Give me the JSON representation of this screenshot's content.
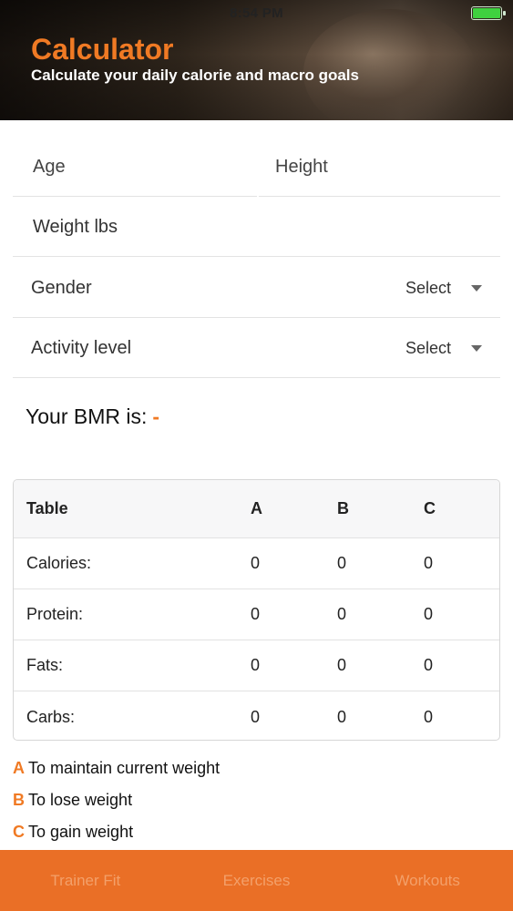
{
  "status_bar": {
    "time": "8:54 PM",
    "battery_level": 1.0
  },
  "header": {
    "title": "Calculator",
    "subtitle": "Calculate your daily calorie and macro goals"
  },
  "form": {
    "age_placeholder": "Age",
    "height_placeholder": "Height",
    "weight_placeholder": "Weight lbs",
    "gender_label": "Gender",
    "gender_value": "Select",
    "activity_label": "Activity level",
    "activity_value": "Select"
  },
  "bmr": {
    "label": "Your BMR is:",
    "value": "-"
  },
  "table": {
    "headers": [
      "Table",
      "A",
      "B",
      "C"
    ],
    "rows": [
      {
        "label": "Calories:",
        "a": "0",
        "b": "0",
        "c": "0"
      },
      {
        "label": "Protein:",
        "a": "0",
        "b": "0",
        "c": "0"
      },
      {
        "label": "Fats:",
        "a": "0",
        "b": "0",
        "c": "0"
      },
      {
        "label": "Carbs:",
        "a": "0",
        "b": "0",
        "c": "0"
      }
    ]
  },
  "legend": [
    {
      "key": "A",
      "text": "To maintain current weight"
    },
    {
      "key": "B",
      "text": "To lose weight"
    },
    {
      "key": "C",
      "text": "To gain weight"
    }
  ],
  "tabbar": {
    "tabs": [
      "Trainer Fit",
      "Exercises",
      "Workouts"
    ]
  },
  "colors": {
    "accent": "#f07a24",
    "tabbar": "#ea6f26",
    "battery": "#3fd13f"
  }
}
